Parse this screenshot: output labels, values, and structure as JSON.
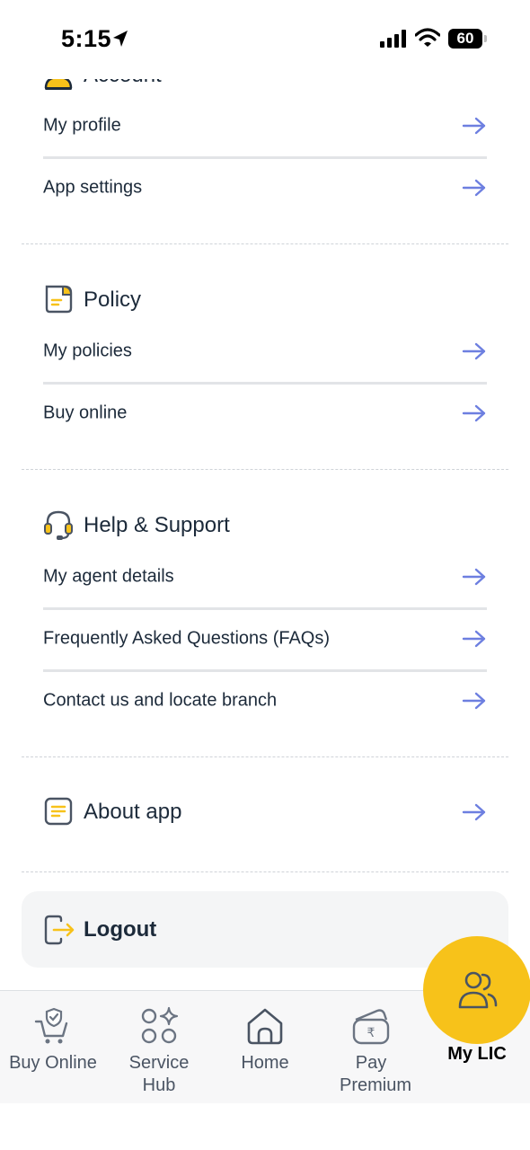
{
  "status_bar": {
    "time": "5:15",
    "battery": "60"
  },
  "partial_section": {
    "title": "Account",
    "icon": "user-icon"
  },
  "account": {
    "items": [
      {
        "label": "My profile",
        "icon": "arrow-right-icon"
      },
      {
        "label": "App settings",
        "icon": "arrow-right-icon"
      }
    ]
  },
  "policy": {
    "title": "Policy",
    "icon": "document-icon",
    "items": [
      {
        "label": "My policies",
        "icon": "arrow-right-icon"
      },
      {
        "label": "Buy online",
        "icon": "arrow-right-icon"
      }
    ]
  },
  "help": {
    "title": "Help & Support",
    "icon": "headset-icon",
    "items": [
      {
        "label": "My agent details",
        "icon": "arrow-right-icon"
      },
      {
        "label": "Frequently Asked Questions (FAQs)",
        "icon": "arrow-right-icon"
      },
      {
        "label": "Contact us and locate branch",
        "icon": "arrow-right-icon"
      }
    ]
  },
  "about": {
    "title": "About app",
    "icon": "note-icon"
  },
  "logout": {
    "label": "Logout",
    "icon": "logout-icon"
  },
  "bottom_nav": {
    "items": [
      {
        "label": "Buy Online",
        "icon": "cart-shield-icon"
      },
      {
        "label": "Service Hub",
        "icon": "apps-sparkle-icon"
      },
      {
        "label": "Home",
        "icon": "home-icon"
      },
      {
        "label": "Pay Premium",
        "icon": "wallet-rupee-icon"
      },
      {
        "label": "My LIC",
        "icon": "users-icon",
        "active": true
      }
    ]
  },
  "colors": {
    "accent_yellow": "#f7c21a",
    "arrow": "#6d7fe0",
    "text": "#1c2a3a",
    "nav_text": "#4a5463"
  }
}
